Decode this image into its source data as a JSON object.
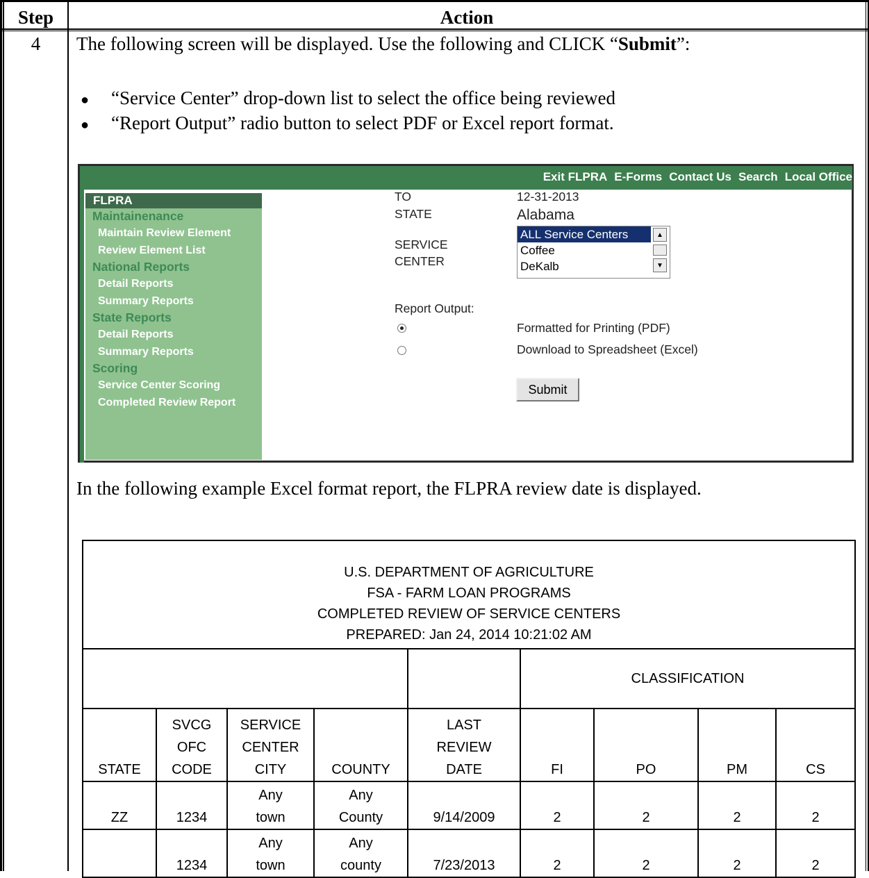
{
  "header": {
    "step_label": "Step",
    "action_label": "Action"
  },
  "step": {
    "number": "4",
    "intro_prefix": "The following screen will be displayed.  Use the following and CLICK “",
    "intro_bold": "Submit",
    "intro_suffix": "”:",
    "bullets": [
      "“Service Center” drop-down list to select the office being reviewed",
      "“Report Output” radio button to select PDF or Excel report format."
    ],
    "example_text": "In the following example Excel format report, the FLPRA review date is displayed."
  },
  "app": {
    "topnav": [
      "Exit FLPRA",
      "E-Forms",
      "Contact Us",
      "Search",
      "Local Office"
    ],
    "sidebar": {
      "title": "FLPRA",
      "sections": [
        {
          "label": "Maintainenance",
          "items": [
            "Maintain Review Element",
            "Review Element List"
          ]
        },
        {
          "label": "National Reports",
          "items": [
            "Detail Reports",
            "Summary Reports"
          ]
        },
        {
          "label": "State Reports",
          "items": [
            "Detail Reports",
            "Summary Reports"
          ]
        },
        {
          "label": "Scoring",
          "items": [
            "Service Center Scoring",
            "Completed Review Report"
          ]
        }
      ]
    },
    "form": {
      "to_label": "TO",
      "to_value": "12-31-2013",
      "state_label": "STATE",
      "state_value": "Alabama",
      "service_label_1": "SERVICE",
      "service_label_2": "CENTER",
      "service_options": [
        "ALL Service Centers",
        "Coffee",
        "DeKalb"
      ],
      "service_selected": "ALL Service Centers",
      "report_output_label": "Report Output:",
      "output_options": [
        {
          "label": "Formatted for Printing (PDF)",
          "checked": true
        },
        {
          "label": "Download to Spreadsheet (Excel)",
          "checked": false
        }
      ],
      "submit_label": "Submit"
    }
  },
  "report": {
    "title_lines": [
      "U.S. DEPARTMENT OF AGRICULTURE",
      "FSA - FARM LOAN PROGRAMS",
      "COMPLETED REVIEW OF SERVICE CENTERS",
      "PREPARED:  Jan 24, 2014 10:21:02 AM"
    ],
    "classification_label": "CLASSIFICATION",
    "columns": [
      [
        "STATE"
      ],
      [
        "SVCG",
        "OFC",
        "CODE"
      ],
      [
        "SERVICE",
        "CENTER",
        "CITY"
      ],
      [
        "COUNTY"
      ],
      [
        "LAST",
        "REVIEW",
        "DATE"
      ],
      [
        "FI"
      ],
      [
        "PO"
      ],
      [
        "PM"
      ],
      [
        "CS"
      ]
    ],
    "rows": [
      {
        "state": "ZZ",
        "code": "1234",
        "city_1": "Any",
        "city_2": "town",
        "county_1": "Any",
        "county_2": "County",
        "date": "9/14/2009",
        "fi": "2",
        "po": "2",
        "pm": "2",
        "cs": "2"
      },
      {
        "state": "",
        "code": "1234",
        "city_1": "Any",
        "city_2": "town",
        "county_1": "Any",
        "county_2": "county",
        "date": "7/23/2013",
        "fi": "2",
        "po": "2",
        "pm": "2",
        "cs": "2"
      }
    ]
  }
}
